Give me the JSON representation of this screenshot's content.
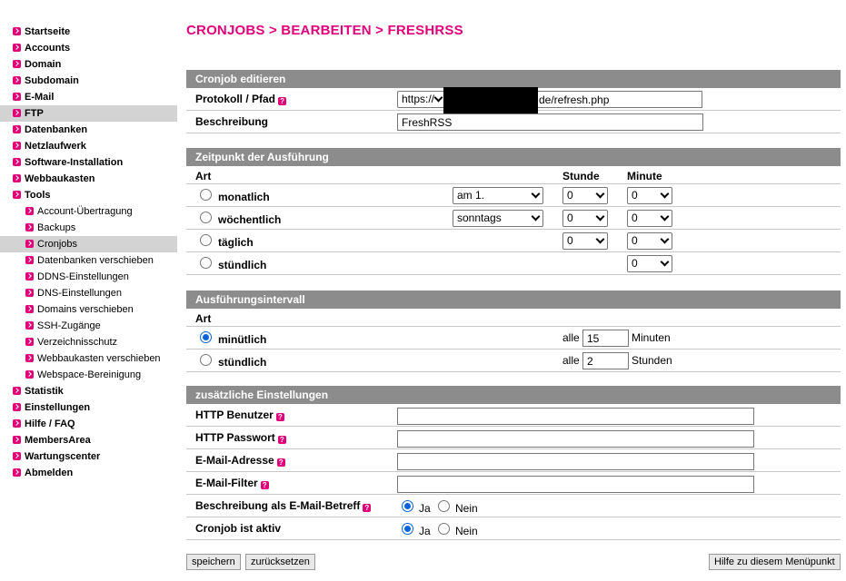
{
  "sidebar": {
    "items": [
      {
        "label": "Startseite"
      },
      {
        "label": "Accounts"
      },
      {
        "label": "Domain"
      },
      {
        "label": "Subdomain"
      },
      {
        "label": "E-Mail"
      },
      {
        "label": "FTP",
        "active": true
      },
      {
        "label": "Datenbanken"
      },
      {
        "label": "Netzlaufwerk"
      },
      {
        "label": "Software-Installation"
      },
      {
        "label": "Webbaukasten"
      },
      {
        "label": "Tools"
      },
      {
        "label": "Account-Übertragung",
        "sub": true
      },
      {
        "label": "Backups",
        "sub": true
      },
      {
        "label": "Cronjobs",
        "sub": true,
        "active": true
      },
      {
        "label": "Datenbanken verschieben",
        "sub": true
      },
      {
        "label": "DDNS-Einstellungen",
        "sub": true
      },
      {
        "label": "DNS-Einstellungen",
        "sub": true
      },
      {
        "label": "Domains verschieben",
        "sub": true
      },
      {
        "label": "SSH-Zugänge",
        "sub": true
      },
      {
        "label": "Verzeichnisschutz",
        "sub": true
      },
      {
        "label": "Webbaukasten verschieben",
        "sub": true
      },
      {
        "label": "Webspace-Bereinigung",
        "sub": true
      },
      {
        "label": "Statistik"
      },
      {
        "label": "Einstellungen"
      },
      {
        "label": "Hilfe / FAQ"
      },
      {
        "label": "MembersArea"
      },
      {
        "label": "Wartungscenter"
      },
      {
        "label": "Abmelden"
      }
    ]
  },
  "page_title": "CRONJOBS > BEARBEITEN > FRESHRSS",
  "cronjob": {
    "header": "Cronjob editieren",
    "protocol_label": "Protokoll / Pfad",
    "protocol_value": "https://",
    "path_value": "de/refresh.php",
    "description_label": "Beschreibung",
    "description_value": "FreshRSS"
  },
  "schedule": {
    "header": "Zeitpunkt der Ausführung",
    "col_art": "Art",
    "col_stunde": "Stunde",
    "col_minute": "Minute",
    "rows": [
      {
        "label": "monatlich",
        "day": "am 1.",
        "hour": "0",
        "minute": "0"
      },
      {
        "label": "wöchentlich",
        "day": "sonntags",
        "hour": "0",
        "minute": "0"
      },
      {
        "label": "täglich",
        "hour": "0",
        "minute": "0"
      },
      {
        "label": "stündlich",
        "minute": "0"
      }
    ]
  },
  "interval": {
    "header": "Ausführungsintervall",
    "col_art": "Art",
    "rows": [
      {
        "label": "minütlich",
        "prefix": "alle",
        "value": "15",
        "unit": "Minuten",
        "checked": true
      },
      {
        "label": "stündlich",
        "prefix": "alle",
        "value": "2",
        "unit": "Stunden",
        "checked": false
      }
    ]
  },
  "extra": {
    "header": "zusätzliche Einstellungen",
    "http_user_label": "HTTP Benutzer",
    "http_pass_label": "HTTP Passwort",
    "email_label": "E-Mail-Adresse",
    "email_filter_label": "E-Mail-Filter",
    "subject_label": "Beschreibung als E-Mail-Betreff",
    "active_label": "Cronjob ist aktiv",
    "yes": "Ja",
    "no": "Nein"
  },
  "buttons": {
    "save": "speichern",
    "reset": "zurücksetzen",
    "help": "Hilfe zu diesem Menüpunkt"
  },
  "colors": {
    "accent": "#e2007a",
    "section_header": "#8c8c8c",
    "radio_checked": "#0a64d8"
  }
}
